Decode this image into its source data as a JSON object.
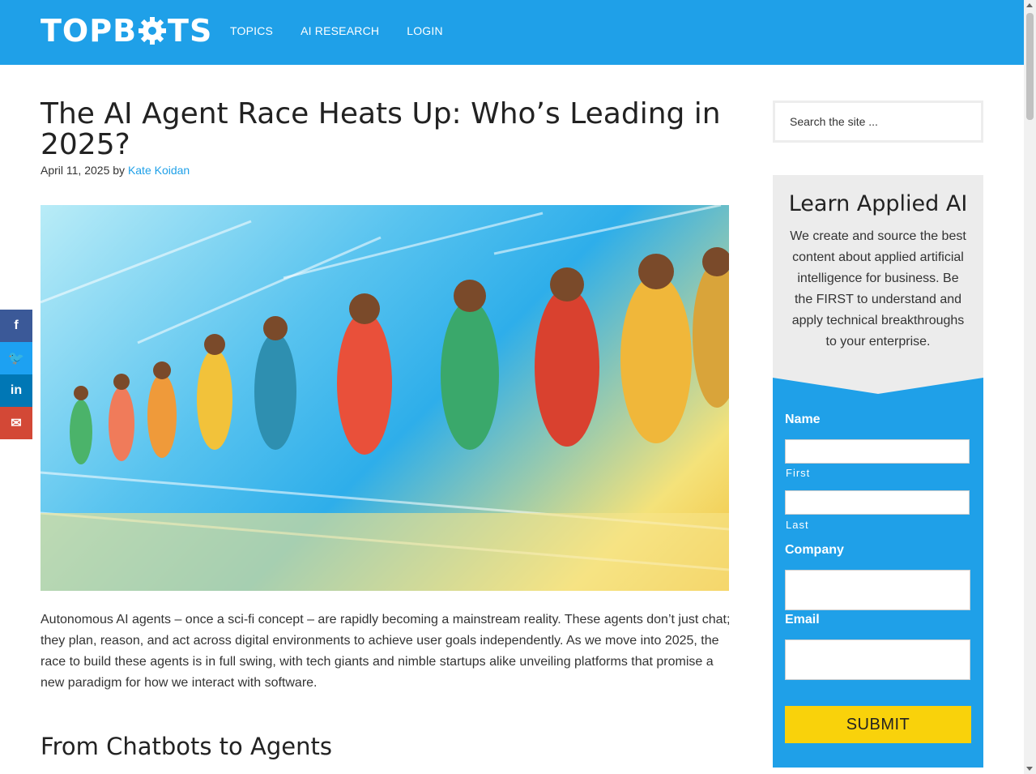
{
  "header": {
    "logo_text_left": "TOPB",
    "logo_text_right": "TS",
    "nav": [
      {
        "label": "TOPICS"
      },
      {
        "label": "AI RESEARCH"
      },
      {
        "label": "LOGIN"
      }
    ]
  },
  "article": {
    "title": "The AI Agent Race Heats Up: Who’s Leading in 2025?",
    "date": "April 11, 2025",
    "by": "by",
    "author": "Kate Koidan",
    "intro": "Autonomous AI agents – once a sci-fi concept – are rapidly becoming a mainstream reality. These agents don’t just chat; they plan, reason, and act across digital environments to achieve user goals independently. As we move into 2025, the race to build these agents is in full swing, with tech giants and nimble startups alike unveiling platforms that promise a new paradigm for how we interact with software.",
    "section_heading": "From Chatbots to Agents"
  },
  "social": [
    {
      "icon": "facebook-icon",
      "glyph": "f",
      "color": "#3b5998"
    },
    {
      "icon": "twitter-icon",
      "glyph": "🐦",
      "color": "#1da1f2"
    },
    {
      "icon": "linkedin-icon",
      "glyph": "in",
      "color": "#0077b5"
    },
    {
      "icon": "email-icon",
      "glyph": "✉",
      "color": "#d34836"
    }
  ],
  "sidebar": {
    "search_placeholder": "Search the site ...",
    "widget_title": "Learn Applied AI",
    "widget_text": "We create and source the best content about applied artificial intelligence for business. Be the FIRST to understand and apply technical breakthroughs to your enterprise.",
    "form": {
      "name_label": "Name",
      "first_label": "First",
      "last_label": "Last",
      "company_label": "Company",
      "email_label": "Email",
      "submit_label": "SUBMIT"
    }
  },
  "colors": {
    "brand_blue": "#1fa0e8",
    "submit_yellow": "#f9d20b",
    "widget_gray": "#ececec"
  }
}
